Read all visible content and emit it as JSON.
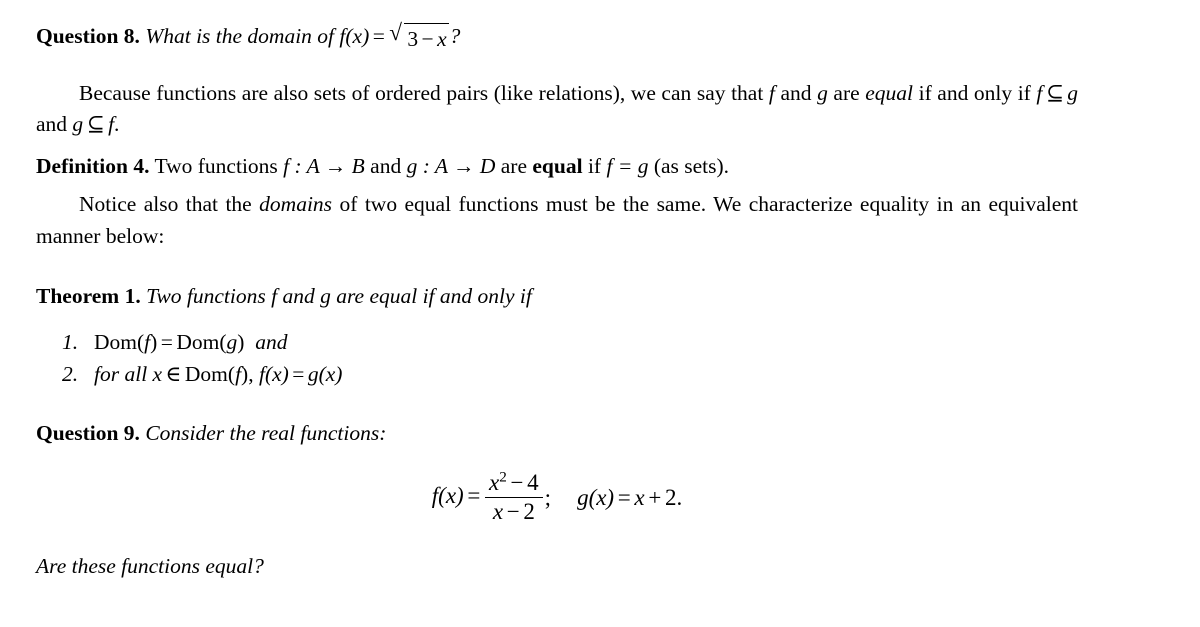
{
  "document": {
    "question8": {
      "label": "Question 8.",
      "text_before": "What is the domain of",
      "fx": "f(x)",
      "equals": "=",
      "radical_sign": "√",
      "radicand_a": "3",
      "radicand_minus": "−",
      "radicand_b": "x",
      "question_mark": "?"
    },
    "paragraph1": {
      "part1": "Because functions are also sets of ordered pairs (like relations), we can say that",
      "var_f": "f",
      "and": "and",
      "var_g": "g",
      "part2": "are",
      "emph_equal": "equal",
      "part3": "if and only if",
      "subset": "⊆",
      "part4": "and",
      "period": "."
    },
    "definition4": {
      "label": "Definition 4.",
      "text1": "Two functions",
      "f_map": "f : A → B",
      "and": "and",
      "g_map": "g : A → D",
      "text2": "are",
      "bold_equal": "equal",
      "text3": "if",
      "eq_fg": "f = g",
      "text4": "(as sets)."
    },
    "paragraph2": {
      "part1": "Notice also that the",
      "emph_domains": "domains",
      "part2": "of two equal functions must be the same. We characterize equality in an equivalent manner below:"
    },
    "theorem1": {
      "label": "Theorem 1.",
      "statement": "Two functions f and g are equal if and only if",
      "items": [
        {
          "num": "1.",
          "dom": "Dom",
          "open": "(",
          "arg1": "f",
          "close": ")",
          "equals": "=",
          "dom2": "Dom",
          "arg2": "g",
          "trailing_and": "and"
        },
        {
          "num": "2.",
          "for_all": "for all",
          "var_x": "x",
          "in": "∈",
          "dom": "Dom",
          "arg": "f",
          "comma": ",",
          "fx": "f(x)",
          "equals": "=",
          "gx": "g(x)"
        }
      ]
    },
    "question9": {
      "label": "Question 9.",
      "text": "Consider the real functions:"
    },
    "display_equation": {
      "fx": "f(x)",
      "equals1": "=",
      "numerator_base": "x",
      "numerator_exp": "2",
      "numerator_minus": "−",
      "numerator_const": "4",
      "denominator_var": "x",
      "denominator_minus": "−",
      "denominator_const": "2",
      "semicolon": ";",
      "gx": "g(x)",
      "equals2": "=",
      "rhs_var": "x",
      "rhs_plus": "+",
      "rhs_const": "2",
      "rhs_period": "."
    },
    "closing_question": {
      "text": "Are these functions equal?"
    },
    "colors": {
      "text": "#000000",
      "background": "#ffffff"
    }
  }
}
